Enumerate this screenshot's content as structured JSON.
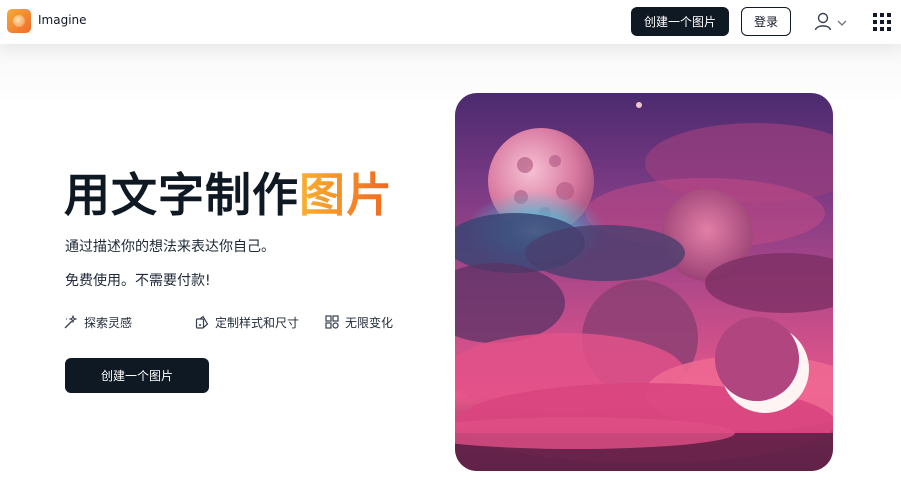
{
  "header": {
    "brand": "Imagine",
    "create_button": "创建一个图片",
    "login_button": "登录"
  },
  "hero": {
    "title_main": "用文字制作",
    "title_accent": "图片",
    "subtitle_1": "通过描述你的想法来表达你自己。",
    "subtitle_2": "免费使用。不需要付款!",
    "features": [
      {
        "label": "探索灵感",
        "icon": "wand-icon"
      },
      {
        "label": "定制样式和尺寸",
        "icon": "palette-icon"
      },
      {
        "label": "无限变化",
        "icon": "grid-icon"
      }
    ],
    "cta": "创建一个图片"
  },
  "colors": {
    "primary_dark": "#0f1924",
    "accent_start": "#f8b131",
    "accent_end": "#f2651f"
  }
}
